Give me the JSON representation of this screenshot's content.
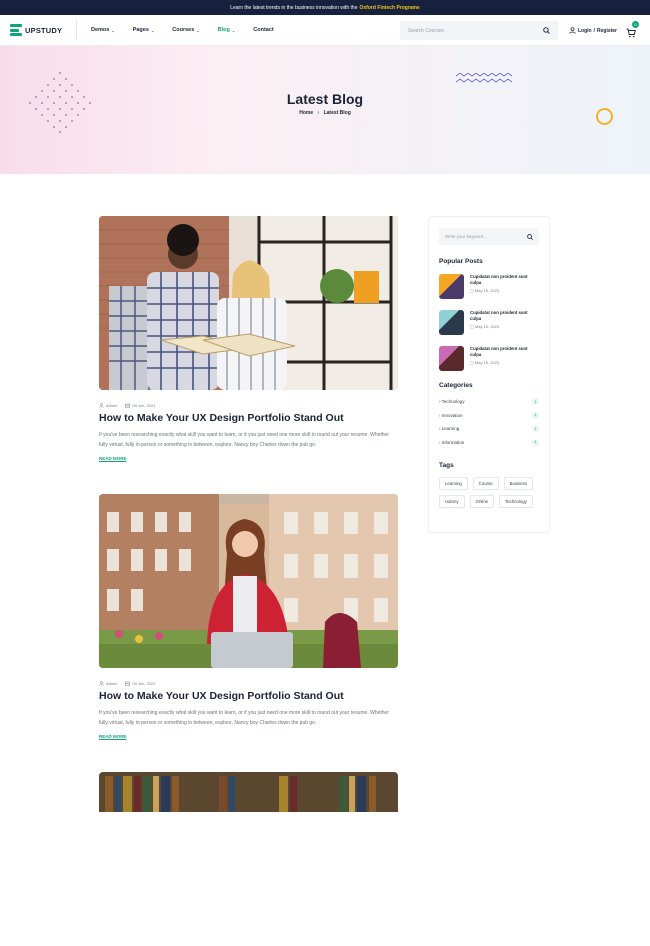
{
  "topbar": {
    "text": "Learn the latest trends in the business innovation with the",
    "highlight": "Oxford Fintech Programe"
  },
  "header": {
    "logo_text": "UPSTUDY",
    "nav": [
      {
        "label": "Demos",
        "has_dropdown": true,
        "active": false
      },
      {
        "label": "Pages",
        "has_dropdown": true,
        "active": false
      },
      {
        "label": "Courses",
        "has_dropdown": true,
        "active": false
      },
      {
        "label": "Blog",
        "has_dropdown": true,
        "active": true
      },
      {
        "label": "Contact",
        "has_dropdown": false,
        "active": false
      }
    ],
    "search_placeholder": "Search Courses",
    "login_label": "Login",
    "register_label": "Register",
    "cart_count": "0"
  },
  "hero": {
    "title": "Latest Blog",
    "breadcrumb_home": "Home",
    "breadcrumb_current": "Latest Blog"
  },
  "posts": [
    {
      "author": "Admin",
      "date": "09 Jun, 2021",
      "title": "How to Make Your UX Design Portfolio Stand Out",
      "excerpt": "If you've been researching exactly what skill you want to learn, or if you just need one more skill to round out your resume. Whether fully virtual, fully in-person or something in between, explore. Nancy boy Charles down the pub go.",
      "read_more": "READ MORE"
    },
    {
      "author": "Admin",
      "date": "09 Jun, 2021",
      "title": "How to Make Your UX Design Portfolio Stand Out",
      "excerpt": "If you've been researching exactly what skill you want to learn, or if you just need one more skill to round out your resume. Whether fully virtual, fully in-person or something in between, explore. Nancy boy Charles down the pub go.",
      "read_more": "READ MORE"
    }
  ],
  "sidebar": {
    "search_placeholder": "Write your keyword...",
    "popular_heading": "Popular Posts",
    "popular_posts": [
      {
        "title": "Cupidatat non proident sunt culpa",
        "date": "May 15, 2023"
      },
      {
        "title": "Cupidatat non proident sunt culpa",
        "date": "May 15, 2023"
      },
      {
        "title": "Cupidatat non proident sunt culpa",
        "date": "May 15, 2023"
      }
    ],
    "categories_heading": "Categories",
    "categories": [
      {
        "label": "Technology",
        "count": "1"
      },
      {
        "label": "Innovation",
        "count": "1"
      },
      {
        "label": "Learning",
        "count": "1"
      },
      {
        "label": "Information",
        "count": "1"
      }
    ],
    "tags_heading": "Tags",
    "tags": [
      "Learning",
      "Course",
      "Business",
      "Udemy",
      "Online",
      "Technology"
    ]
  },
  "colors": {
    "brand": "#0ea47a",
    "topbar_bg": "#16213e",
    "highlight": "#f5c518",
    "accent_ring": "#f0b429"
  }
}
